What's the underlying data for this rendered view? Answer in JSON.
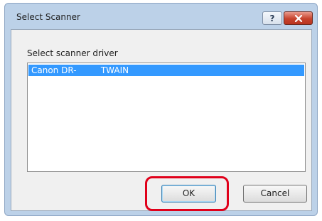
{
  "window": {
    "title": "Select Scanner",
    "help_icon": "help-icon",
    "close_icon": "close-icon"
  },
  "dialog": {
    "label": "Select scanner driver",
    "list_items": [
      {
        "text": "Canon DR-         TWAIN",
        "selected": true
      }
    ],
    "ok_label": "OK",
    "cancel_label": "Cancel",
    "highlight_color": "#e0001a",
    "selection_color": "#3399ff"
  }
}
